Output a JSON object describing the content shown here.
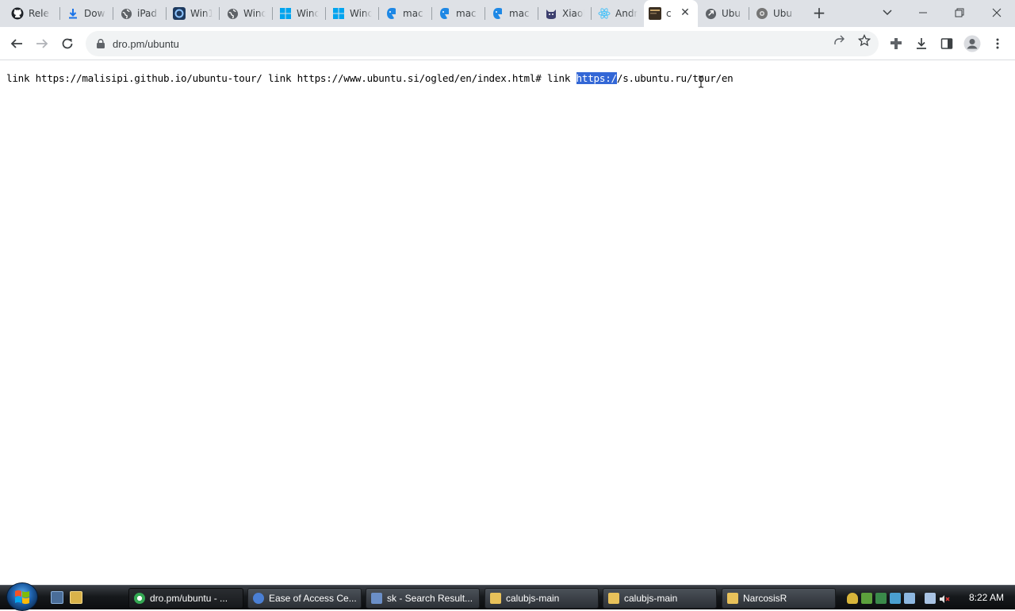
{
  "browser": {
    "tabs": [
      {
        "title": "Rele",
        "icon": "github-icon",
        "color": "#1f2328"
      },
      {
        "title": "Dow",
        "icon": "download-icon",
        "color": "#1a73e8"
      },
      {
        "title": "iPad",
        "icon": "globe-icon",
        "color": "#5f6368"
      },
      {
        "title": "Win1",
        "icon": "app-icon",
        "color": "#1e3a5f"
      },
      {
        "title": "Wind",
        "icon": "globe-icon",
        "color": "#5f6368"
      },
      {
        "title": "Wind",
        "icon": "windows-icon",
        "color": "#00a4ef"
      },
      {
        "title": "Wind",
        "icon": "windows-icon",
        "color": "#00a4ef"
      },
      {
        "title": "mac",
        "icon": "finder-icon",
        "color": "#1e88e5"
      },
      {
        "title": "mac",
        "icon": "finder-icon",
        "color": "#1e88e5"
      },
      {
        "title": "mac",
        "icon": "finder-icon",
        "color": "#1e88e5"
      },
      {
        "title": "Xiaol",
        "icon": "cat-icon",
        "color": "#3c3f6e"
      },
      {
        "title": "Andr",
        "icon": "atom-icon",
        "color": "#4fc3f7"
      },
      {
        "title": "c",
        "icon": "terminal-icon",
        "color": "#3b2f22",
        "active": true
      },
      {
        "title": "Ubu",
        "icon": "link-icon",
        "color": "#5f6368"
      },
      {
        "title": "Ubu",
        "icon": "settings-icon",
        "color": "#757575"
      }
    ],
    "new_tab_label": "+",
    "url": "dro.pm/ubuntu"
  },
  "content": {
    "before_selection": "link https://malisipi.github.io/ubuntu-tour/ link https://www.ubuntu.si/ogled/en/index.html# link ",
    "selection": "https:/",
    "after_selection": "/s.ubuntu.ru/tour/en"
  },
  "taskbar": {
    "tasks": [
      {
        "label": "dro.pm/ubuntu - ...",
        "icon_color": "#34a853",
        "active": true
      },
      {
        "label": "Ease of Access Ce...",
        "icon_color": "#4a7fd4"
      },
      {
        "label": "sk - Search Result...",
        "icon_color": "#6b8fc7"
      },
      {
        "label": "calubjs-main",
        "icon_color": "#e8c15a"
      },
      {
        "label": "calubjs-main",
        "icon_color": "#e8c15a"
      },
      {
        "label": "NarcosisR",
        "icon_color": "#e8c15a"
      }
    ],
    "clock": "8:22 AM"
  }
}
